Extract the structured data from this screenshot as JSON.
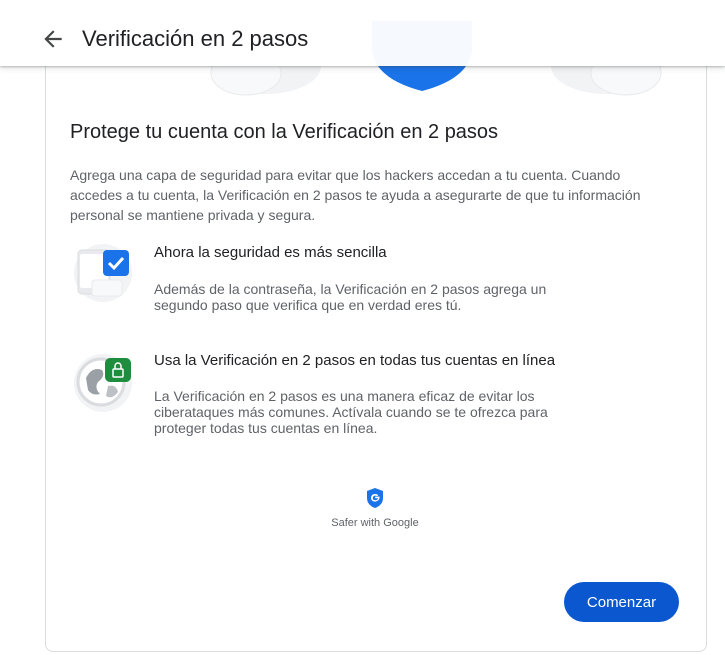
{
  "header": {
    "title": "Verificación en 2 pasos"
  },
  "main": {
    "heading": "Protege tu cuenta con la Verificación en 2 pasos",
    "intro": "Agrega una capa de seguridad para evitar que los hackers accedan a tu cuenta. Cuando accedes a tu cuenta, la Verificación en 2 pasos te ayuda a asegurarte de que tu información personal se mantiene privada y segura.",
    "features": [
      {
        "icon": "checkbox-phone-icon",
        "title": "Ahora la seguridad es más sencilla",
        "description": "Además de la contraseña, la Verificación en 2 pasos agrega un segundo paso que verifica que en verdad eres tú."
      },
      {
        "icon": "globe-lock-icon",
        "title": "Usa la Verificación en 2 pasos en todas tus cuentas en línea",
        "description": "La Verificación en 2 pasos es una manera eficaz de evitar los ciberataques más comunes. Actívala cuando se te ofrezca para proteger todas tus cuentas en línea."
      }
    ],
    "safer_badge": {
      "prefix": "Safer with ",
      "brand": "Google"
    },
    "start_button": "Comenzar"
  },
  "colors": {
    "primary": "#0b57d0",
    "shield": "#1a73e8",
    "lock_green": "#1e8e3e"
  }
}
